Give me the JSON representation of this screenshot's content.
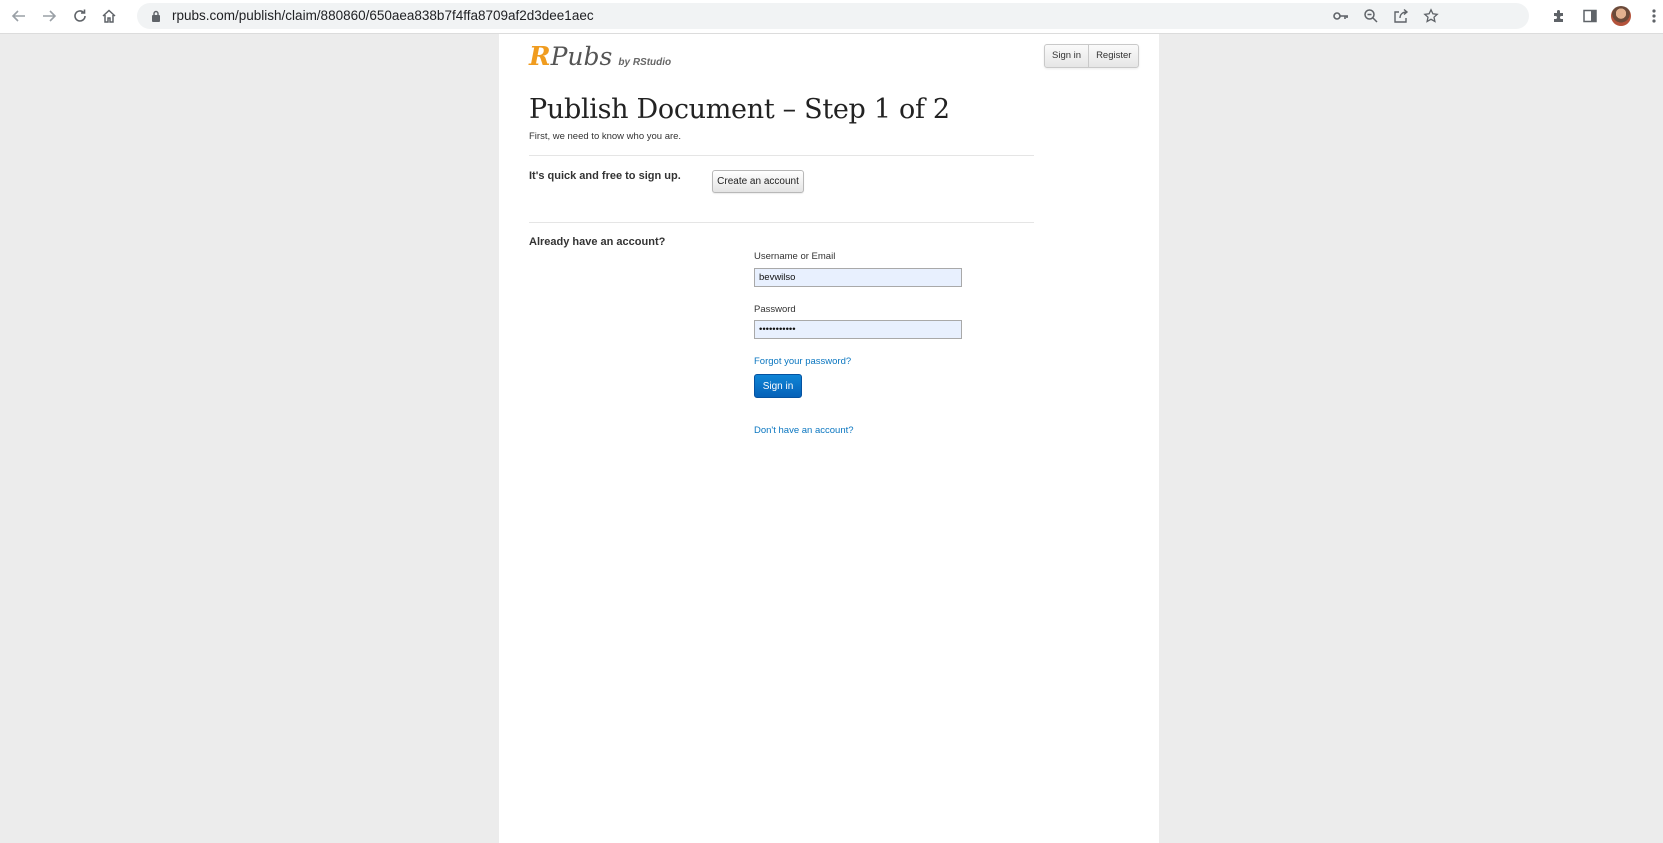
{
  "browser": {
    "url": "rpubs.com/publish/claim/880860/650aea838b7f4ffa8709af2d3dee1aec"
  },
  "site": {
    "logo_r": "R",
    "logo_pubs": "Pubs",
    "logo_by": "by RStudio",
    "header_signin": "Sign in",
    "header_register": "Register"
  },
  "main": {
    "title": "Publish Document – Step 1 of 2",
    "subtitle": "First, we need to know who you are.",
    "signup_prompt": "It's quick and free to sign up.",
    "create_account_label": "Create an account",
    "have_account_prompt": "Already have an account?",
    "username_label": "Username or Email",
    "username_value": "bevwilso",
    "password_label": "Password",
    "password_value": "•••••••••••",
    "forgot_label": "Forgot your password?",
    "signin_label": "Sign in",
    "no_account_label": "Don't have an account?"
  },
  "theme": {
    "accent": "#0a76c0",
    "logo_orange": "#f09c1f"
  }
}
